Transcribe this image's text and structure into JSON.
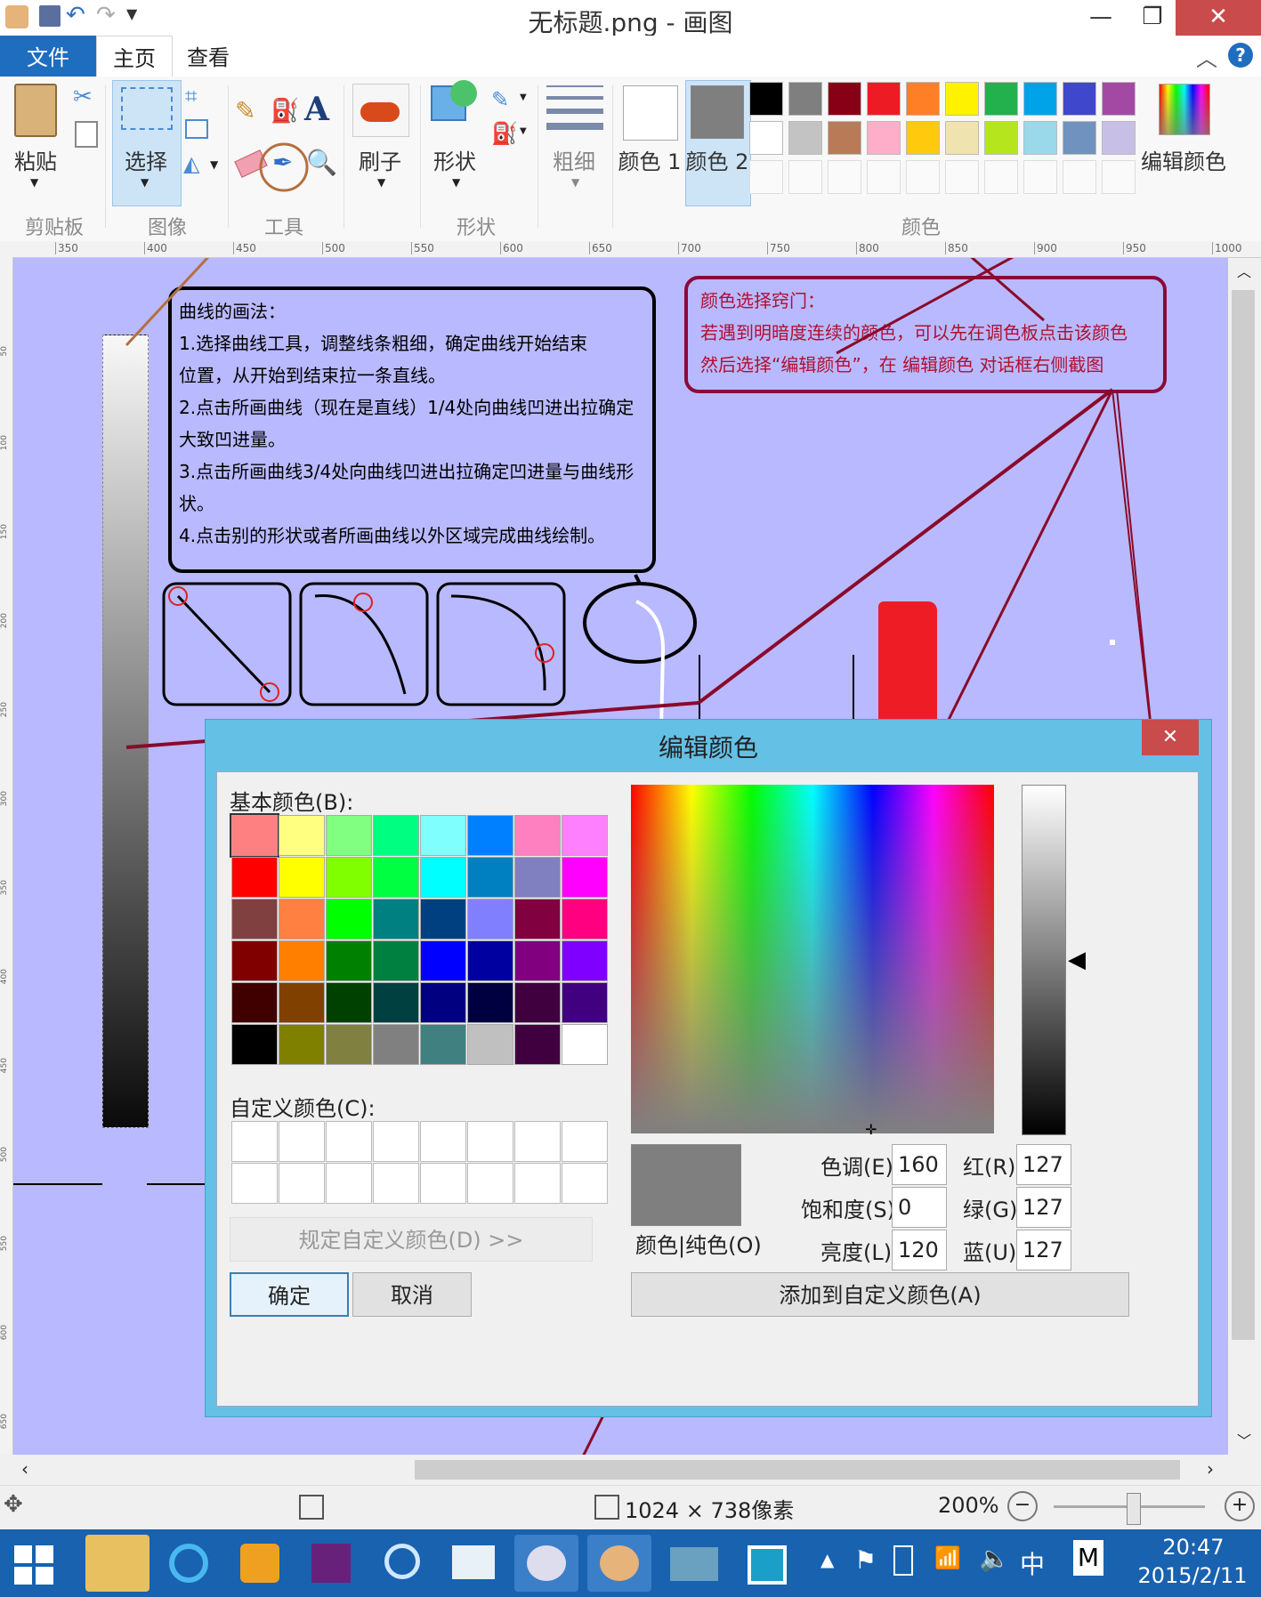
{
  "window": {
    "title": "无标题.png - 画图",
    "minimize": "—",
    "restore": "❐",
    "close": "✕"
  },
  "tabs": {
    "file": "文件",
    "home": "主页",
    "view": "查看"
  },
  "ribbon": {
    "paste": "粘贴",
    "select": "选择",
    "brushes": "刷子",
    "shapes": "形状",
    "size": "粗细",
    "color1": "颜色 1",
    "color2": "颜色 2",
    "edit_colors": "编辑颜色",
    "groups": {
      "clipboard": "剪贴板",
      "image": "图像",
      "tools": "工具",
      "shapes": "形状",
      "colors": "颜色"
    },
    "palette_row1": [
      "#000000",
      "#7f7f7f",
      "#880015",
      "#ed1c24",
      "#ff7f27",
      "#fff200",
      "#22b14c",
      "#00a2e8",
      "#3f48cc",
      "#a349a4"
    ],
    "palette_row2": [
      "#ffffff",
      "#c3c3c3",
      "#b97a57",
      "#ffaec9",
      "#ffc90e",
      "#efe4b0",
      "#b5e61d",
      "#99d9ea",
      "#7092be",
      "#c8bfe7"
    ],
    "color1_value": "#ffffff",
    "color2_value": "#7f7f7f"
  },
  "ruler": {
    "ticks": [
      "350",
      "400",
      "450",
      "500",
      "550",
      "600",
      "650",
      "700",
      "750",
      "800",
      "850",
      "900",
      "950",
      "1000"
    ],
    "vticks": [
      "50",
      "100",
      "150",
      "200",
      "250",
      "300",
      "350",
      "400",
      "450",
      "500",
      "550",
      "600",
      "650"
    ]
  },
  "notes": {
    "curve_title": "曲线的画法：",
    "curve_lines": [
      "1.选择曲线工具，调整线条粗细，确定曲线开始结束",
      "位置，从开始到结束拉一条直线。",
      "2.点击所画曲线（现在是直线）1/4处向曲线凹进出拉确定",
      "大致凹进量。",
      "3.点击所画曲线3/4处向曲线凹进出拉确定凹进量与曲线形",
      "状。",
      "4.点击别的形状或者所画曲线以外区域完成曲线绘制。"
    ],
    "tip_title": "颜色选择窍门：",
    "tip_lines": [
      "若遇到明暗度连续的颜色，可以先在调色板点击该颜色",
      "然后选择“编辑颜色”，在 编辑颜色 对话框右侧截图"
    ]
  },
  "dialog": {
    "title": "编辑颜色",
    "close": "✕",
    "basic_label": "基本颜色(B):",
    "custom_label": "自定义颜色(C):",
    "define_custom": "规定自定义颜色(D) >>",
    "ok": "确定",
    "cancel": "取消",
    "solid_label": "颜色|纯色(O)",
    "hue_label": "色调(E):",
    "hue": "160",
    "sat_label": "饱和度(S):",
    "sat": "0",
    "lum_label": "亮度(L):",
    "lum": "120",
    "red_label": "红(R):",
    "red": "127",
    "green_label": "绿(G):",
    "green": "127",
    "blue_label": "蓝(U):",
    "blue": "127",
    "add_custom": "添加到自定义颜色(A)",
    "basic_colors": [
      [
        "#ff8080",
        "#ffff80",
        "#80ff80",
        "#00ff80",
        "#80ffff",
        "#0080ff",
        "#ff80c0",
        "#ff80ff"
      ],
      [
        "#ff0000",
        "#ffff00",
        "#80ff00",
        "#00ff40",
        "#00ffff",
        "#0080c0",
        "#8080c0",
        "#ff00ff"
      ],
      [
        "#804040",
        "#ff8040",
        "#00ff00",
        "#008080",
        "#004080",
        "#8080ff",
        "#800040",
        "#ff0080"
      ],
      [
        "#800000",
        "#ff8000",
        "#008000",
        "#008040",
        "#0000ff",
        "#0000a0",
        "#800080",
        "#8000ff"
      ],
      [
        "#400000",
        "#804000",
        "#004000",
        "#004040",
        "#000080",
        "#000040",
        "#400040",
        "#400080"
      ],
      [
        "#000000",
        "#808000",
        "#808040",
        "#808080",
        "#408080",
        "#c0c0c0",
        "#400040",
        "#ffffff"
      ]
    ],
    "current_color": "#7f7f7f"
  },
  "status": {
    "dimensions": "1024 × 738像素",
    "zoom": "200%"
  },
  "taskbar": {
    "ime": "中",
    "ime2": "M",
    "time": "20:47",
    "date": "2015/2/11"
  }
}
